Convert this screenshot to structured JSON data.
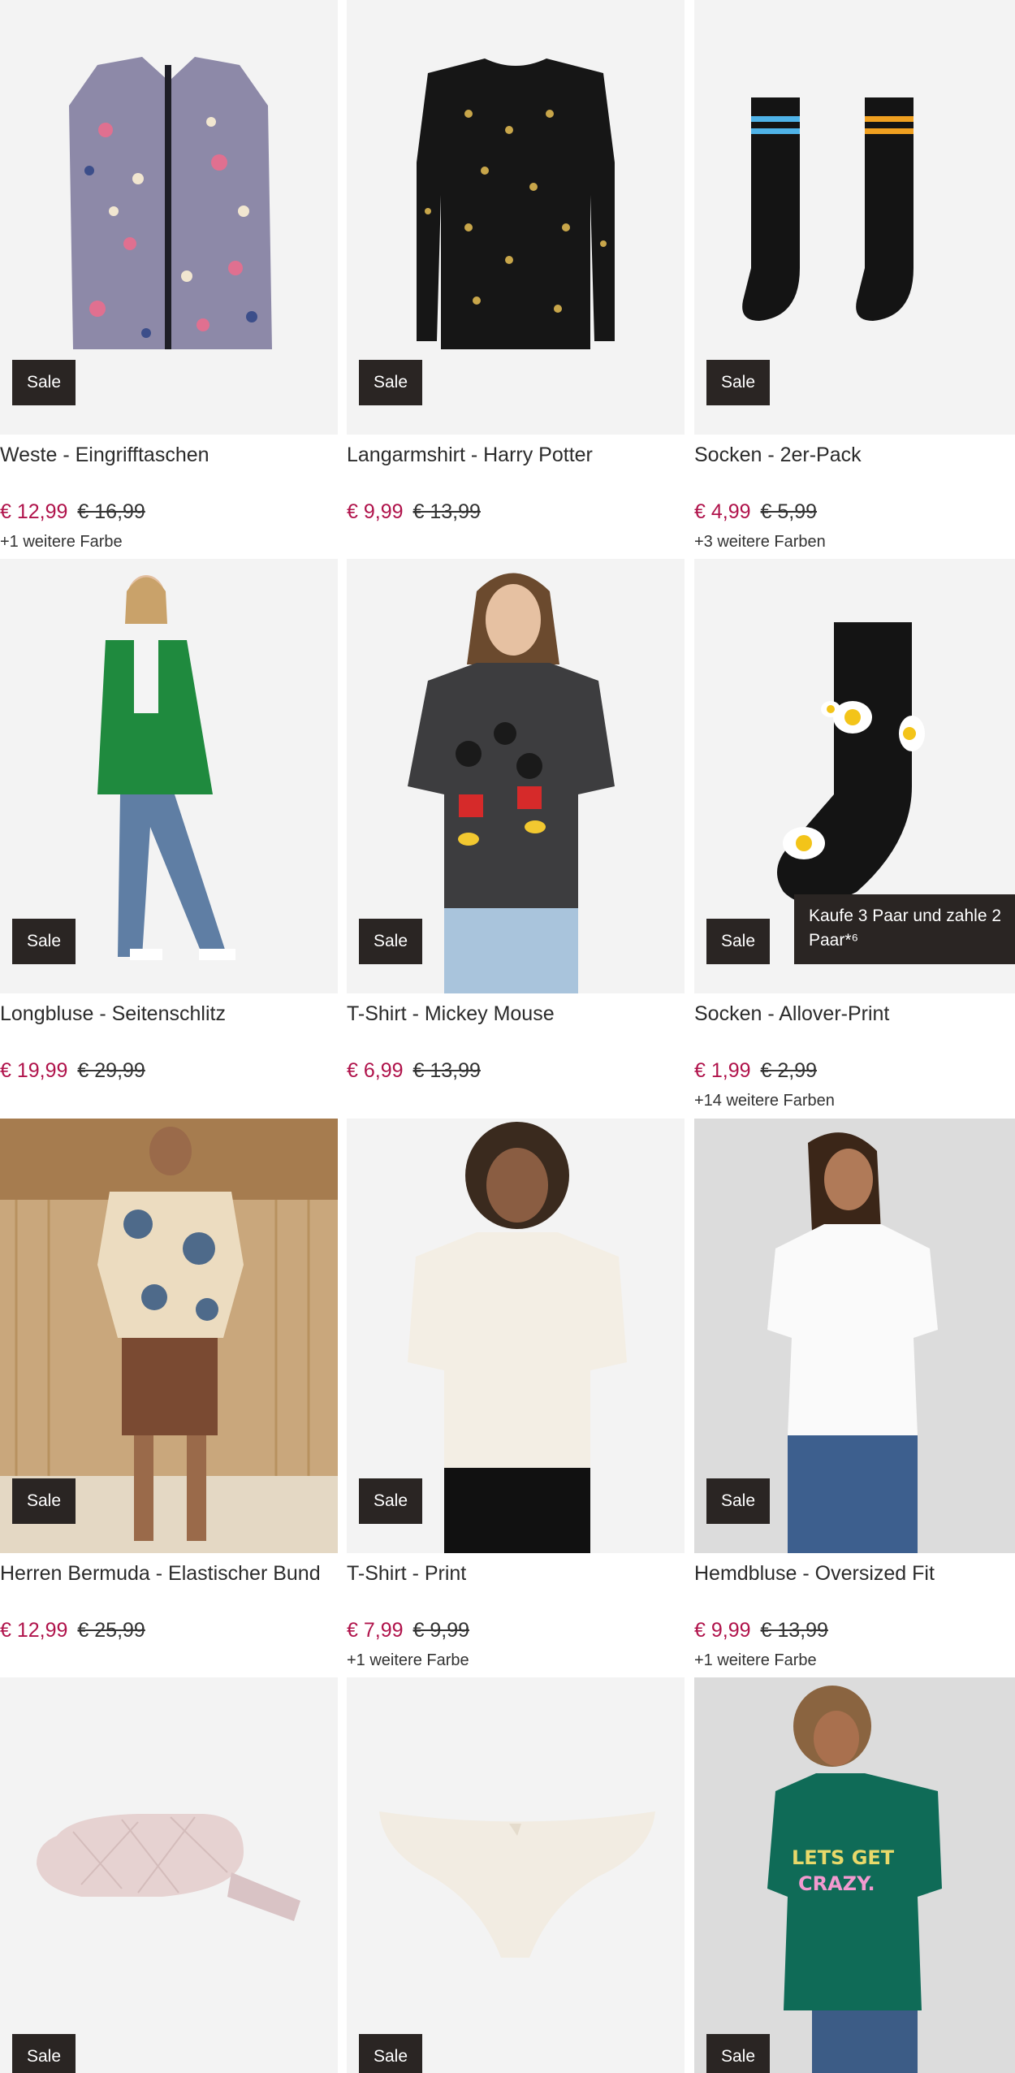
{
  "products": [
    {
      "title": "Weste - Eingrifftaschen",
      "price": "€ 12,99",
      "old_price": "€ 16,99",
      "badge": "Sale",
      "colors": "+1 weitere Farbe",
      "icon": "floral-vest-image"
    },
    {
      "title": "Langarmshirt - Harry Potter",
      "price": "€ 9,99",
      "old_price": "€ 13,99",
      "badge": "Sale",
      "colors": "",
      "icon": "black-longsleeve-image"
    },
    {
      "title": "Socken - 2er-Pack",
      "price": "€ 4,99",
      "old_price": "€ 5,99",
      "badge": "Sale",
      "colors": "+3 weitere Farben",
      "icon": "socks-pair-image"
    },
    {
      "title": "Longbluse - Seitenschlitz",
      "price": "€ 19,99",
      "old_price": "€ 29,99",
      "badge": "Sale",
      "colors": "",
      "icon": "green-blouse-model-image"
    },
    {
      "title": "T-Shirt - Mickey Mouse",
      "price": "€ 6,99",
      "old_price": "€ 13,99",
      "badge": "Sale",
      "colors": "",
      "icon": "mickey-tshirt-model-image"
    },
    {
      "title": "Socken - Allover-Print",
      "price": "€ 1,99",
      "old_price": "€ 2,99",
      "badge": "Sale",
      "colors": "+14 weitere Farben",
      "promo": "Kaufe 3 Paar und zahle 2 Paar*⁶",
      "icon": "egg-sock-image"
    },
    {
      "title": "Herren Bermuda - Elastischer Bund",
      "price": "€ 12,99",
      "old_price": "€ 25,99",
      "badge": "Sale",
      "colors": "",
      "icon": "bermuda-model-image"
    },
    {
      "title": "T-Shirt - Print",
      "price": "€ 7,99",
      "old_price": "€ 9,99",
      "badge": "Sale",
      "colors": "+1 weitere Farbe",
      "icon": "white-tshirt-model-image"
    },
    {
      "title": "Hemdbluse - Oversized Fit",
      "price": "€ 9,99",
      "old_price": "€ 13,99",
      "badge": "Sale",
      "colors": "+1 weitere Farbe",
      "icon": "white-shirt-model-image"
    },
    {
      "title": "",
      "price": "",
      "old_price": "",
      "badge": "Sale",
      "colors": "",
      "icon": "belt-bag-image"
    },
    {
      "title": "",
      "price": "",
      "old_price": "",
      "badge": "Sale",
      "colors": "",
      "icon": "briefs-image"
    },
    {
      "title": "",
      "price": "",
      "old_price": "",
      "badge": "Sale",
      "colors": "",
      "icon": "green-tshirt-model-image"
    }
  ],
  "colors": {
    "sale_price": "#b0134b",
    "badge_bg": "#2a2523",
    "image_bg": "#f3f3f3"
  }
}
